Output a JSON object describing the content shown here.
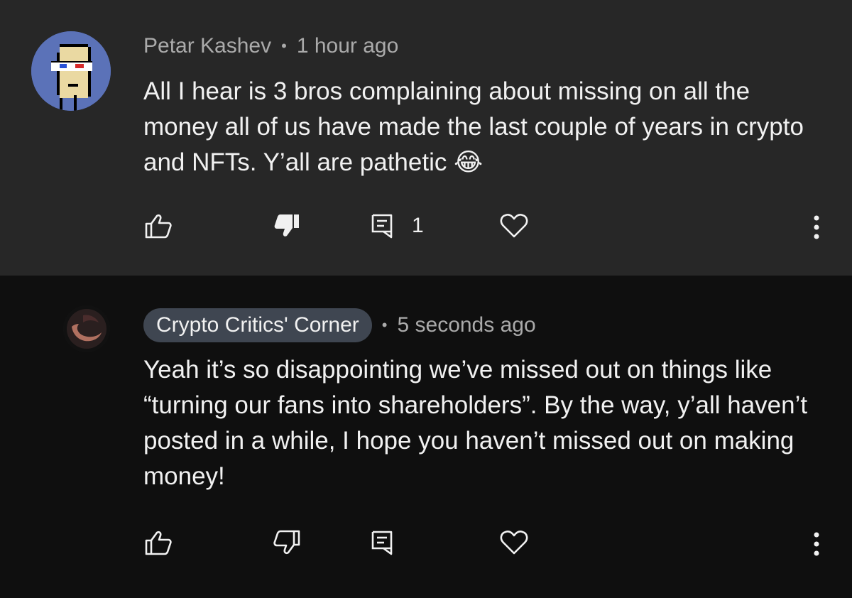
{
  "comments": [
    {
      "author": "Petar Kashev",
      "time": "1 hour ago",
      "text": "All I hear is 3 bros complaining about missing on all the money all of us have made the last couple of years in crypto and NFTs. Y’all are pathetic 😂",
      "reply_count": "1",
      "disliked": true,
      "avatar_icon": "pixel-punk-avatar",
      "background": "#272727"
    },
    {
      "author": "Crypto Critics' Corner",
      "time": "5 seconds ago",
      "text": "Yeah it’s so disappointing we’ve missed out on things like “turning our fans into shareholders”. By the way, y’all haven’t posted in a while, I hope you haven’t missed out on making money!",
      "reply_count": "",
      "disliked": false,
      "avatar_icon": "dark-moon-avatar",
      "background": "#0f0f0f"
    }
  ],
  "separator": "•",
  "colors": {
    "text_primary": "#f1f1f1",
    "text_secondary": "#aaaaaa",
    "author_pill": "#3f4651"
  }
}
